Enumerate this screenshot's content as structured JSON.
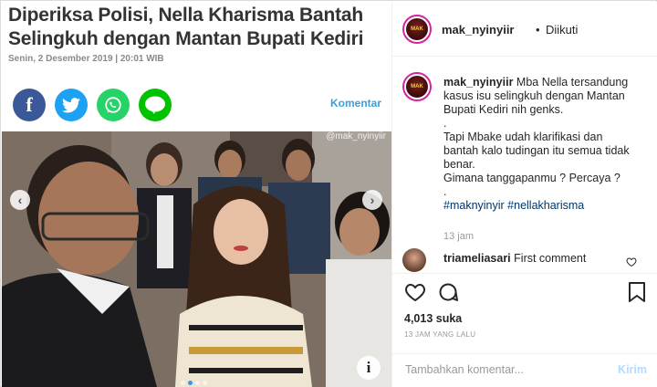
{
  "article": {
    "headline": "Diperiksa Polisi, Nella Kharisma Bantah Selingkuh dengan Mantan Bupati Kediri",
    "dateline": "Senin, 2 Desember 2019 | 20:01 WIB",
    "share_icons": [
      "facebook-icon",
      "twitter-icon",
      "whatsapp-icon",
      "line-icon"
    ],
    "line_label": "LINE",
    "fb_glyph": "f",
    "komentar_label": "Komentar"
  },
  "photo": {
    "watermark": "@mak_nyinyiir",
    "prev_glyph": "‹",
    "next_glyph": "›",
    "info_glyph": "i",
    "slide_count": 4,
    "active_slide": 1
  },
  "post": {
    "username": "mak_nyinyiir",
    "separator": "•",
    "follow_status": "Diikuti",
    "avatar_text": "MAK",
    "caption": {
      "user": "mak_nyinyiir",
      "line1": "Mba Nella tersandung kasus isu selingkuh dengan Mantan Bupati Kediri nih genks.",
      "dot": ".",
      "line2": "Tapi Mbake udah klarifikasi dan bantah kalo tudingan itu semua tidak benar.",
      "line3": "Gimana tanggapanmu ? Percaya ?",
      "dot2": ".",
      "hashtags": "#maknyinyir #nellakharisma"
    },
    "caption_time": "13 jam",
    "comment": {
      "user": "triameliasari",
      "text": "First comment"
    },
    "likes": "4,013 suka",
    "time_ago": "13 JAM YANG LALU",
    "comment_placeholder": "Tambahkan komentar...",
    "send_label": "Kirim"
  },
  "colors": {
    "facebook": "#3b5998",
    "twitter": "#1da1f2",
    "whatsapp": "#25d366",
    "line": "#00c300",
    "link_blue": "#3aa0d8",
    "hashtag": "#003569",
    "send_disabled": "#b3dbff"
  }
}
